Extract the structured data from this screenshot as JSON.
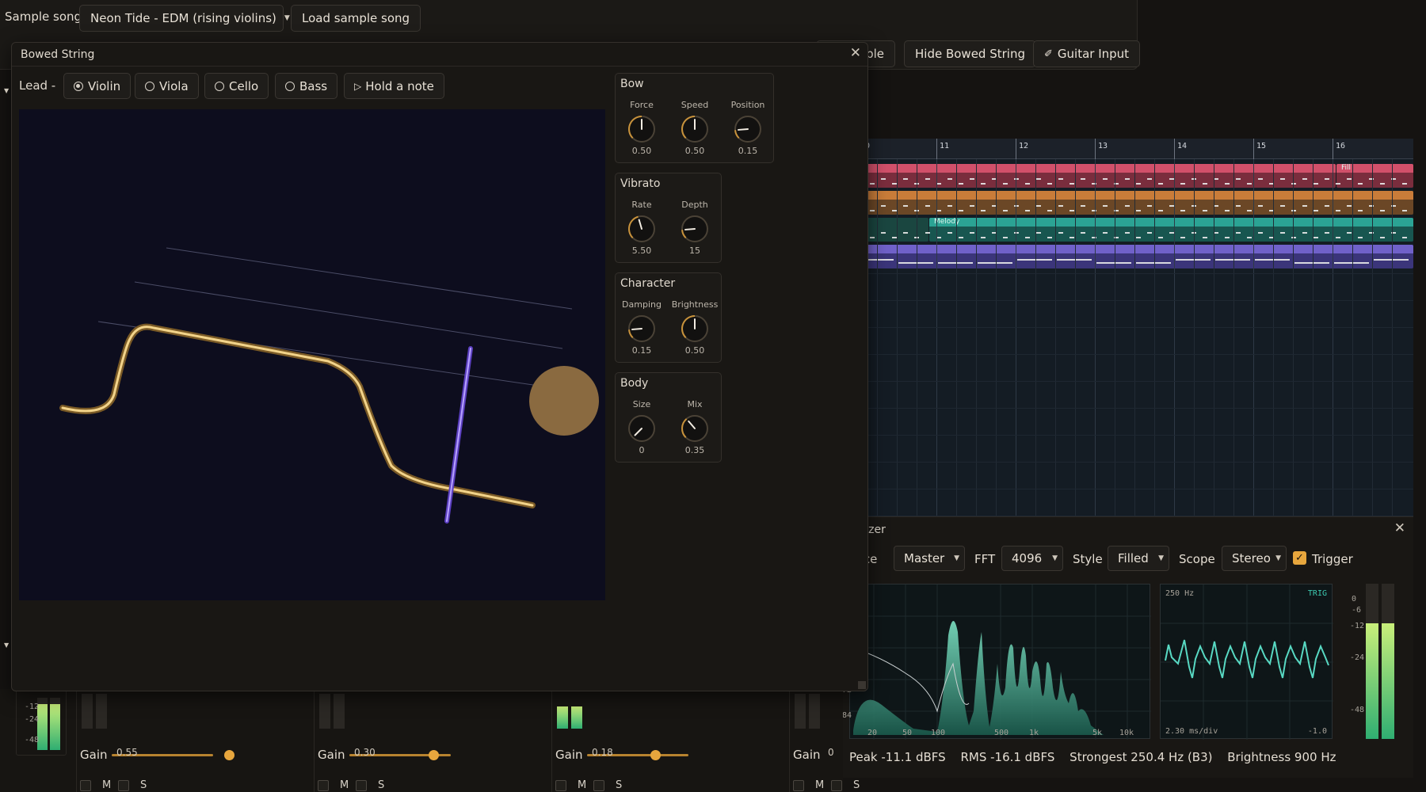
{
  "topbar": {
    "sample_song_label": "Sample song",
    "song_select": "Neon Tide - EDM (rising violins)",
    "load_button": "Load sample song",
    "partial_button": "ble",
    "hide_bowed_button": "Hide Bowed String",
    "guitar_input_button": "Guitar Input",
    "guitar_icon": "guitar-icon"
  },
  "arrangement": {
    "bars": [
      "10",
      "11",
      "12",
      "13",
      "14",
      "15",
      "16"
    ],
    "clips": {
      "fill_label": "Fill",
      "melody_label": "Melody"
    },
    "colors": {
      "track1": "#d1506a",
      "track2": "#c97c39",
      "track3": "#2ba394",
      "track4": "#7061c9"
    }
  },
  "analyzer": {
    "title": "lyzer",
    "source_label": "rce",
    "source_value": "Master",
    "fft_label": "FFT",
    "fft_value": "4096",
    "style_label": "Style",
    "style_value": "Filled",
    "scope_label": "Scope",
    "scope_value": "Stereo",
    "trigger_label": "Trigger",
    "trigger_checked": true,
    "spectrum_y_labels": [
      "-72",
      "-84"
    ],
    "spectrum_x_labels": [
      "20",
      "50",
      "100",
      "500",
      "1k",
      "5k",
      "10k"
    ],
    "scope_freq": "250 Hz",
    "scope_trig": "TRIG",
    "scope_timebase": "2.30 ms/div",
    "scope_level": "-1.0",
    "meter_labels": [
      "0",
      "-6",
      "-12",
      "-24",
      "-48"
    ],
    "readouts": {
      "peak": "Peak -11.1 dBFS",
      "rms": "RMS -16.1 dBFS",
      "strongest": "Strongest 250.4 Hz (B3)",
      "brightness": "Brightness 900 Hz"
    }
  },
  "mixer": {
    "meter_labels": [
      "-12",
      "-24",
      "-48"
    ],
    "strips": [
      {
        "gain_label": "Gain",
        "gain_value": "0.55",
        "gain": 0.55,
        "mute": "M",
        "solo": "S"
      },
      {
        "gain_label": "Gain",
        "gain_value": "0.30",
        "gain": 0.3,
        "mute": "M",
        "solo": "S"
      },
      {
        "gain_label": "Gain",
        "gain_value": "0.18",
        "gain": 0.18,
        "mute": "M",
        "solo": "S"
      },
      {
        "gain_label": "Gain",
        "gain_value": "0",
        "gain": 0,
        "mute": "M",
        "solo": "S"
      }
    ]
  },
  "bowed_window": {
    "title": "Bowed String",
    "lead_label": "Lead -",
    "instruments": [
      "Violin",
      "Viola",
      "Cello",
      "Bass"
    ],
    "selected_instrument": "Violin",
    "hold_button": "Hold a note",
    "play_icon": "play-icon",
    "panels": {
      "bow": {
        "title": "Bow",
        "knobs": [
          {
            "label": "Force",
            "value": "0.50",
            "level": 0.5
          },
          {
            "label": "Speed",
            "value": "0.50",
            "level": 0.5
          },
          {
            "label": "Position",
            "value": "0.15",
            "level": 0.15
          }
        ]
      },
      "vibrato": {
        "title": "Vibrato",
        "knobs": [
          {
            "label": "Rate",
            "value": "5.50",
            "level": 0.44
          },
          {
            "label": "Depth",
            "value": "15",
            "level": 0.15
          }
        ]
      },
      "character": {
        "title": "Character",
        "knobs": [
          {
            "label": "Damping",
            "value": "0.15",
            "level": 0.15
          },
          {
            "label": "Brightness",
            "value": "0.50",
            "level": 0.5
          }
        ]
      },
      "body": {
        "title": "Body",
        "knobs": [
          {
            "label": "Size",
            "value": "0",
            "level": 0.0
          },
          {
            "label": "Mix",
            "value": "0.35",
            "level": 0.35
          }
        ]
      }
    },
    "colors": {
      "string": "#e8c06a",
      "bow": "#8b6cf2",
      "accent": "#e7a63d",
      "canvas": "#0d0d1e"
    }
  }
}
